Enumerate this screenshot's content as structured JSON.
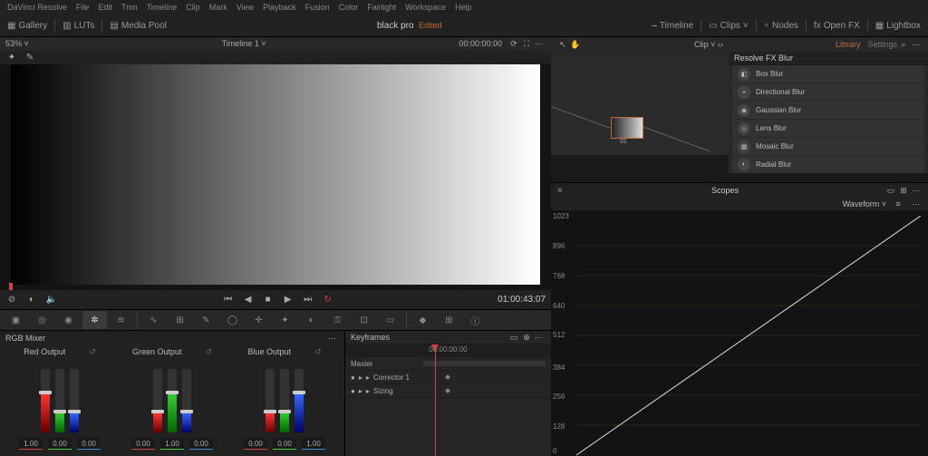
{
  "menubar": [
    "DaVinci Resolve",
    "File",
    "Edit",
    "Trim",
    "Timeline",
    "Clip",
    "Mark",
    "View",
    "Playback",
    "Fusion",
    "Color",
    "Fairlight",
    "Workspace",
    "Help"
  ],
  "topbar": {
    "gallery": "Gallery",
    "luts": "LUTs",
    "mediapool": "Media Pool",
    "project": "black pro",
    "edited": "Edited",
    "timeline": "Timeline",
    "clips": "Clips",
    "nodes": "Nodes",
    "openfx": "Open FX",
    "lightbox": "Lightbox"
  },
  "viewer": {
    "zoom": "53%",
    "title": "Timeline 1",
    "tc_in": "00:00:00:00",
    "tc_master": "01:00:43:07"
  },
  "nodes": {
    "clip_label": "Clip",
    "tab_library": "Library",
    "tab_settings": "Settings",
    "node_label": "01"
  },
  "fx": {
    "header": "Resolve FX Blur",
    "items": [
      "Box Blur",
      "Directional Blur",
      "Gaussian Blur",
      "Lens Blur",
      "Mosaic Blur",
      "Radial Blur"
    ]
  },
  "rgb": {
    "header": "RGB Mixer",
    "red": "Red Output",
    "green": "Green Output",
    "blue": "Blue Output",
    "v1": "1.00",
    "v0": "0.00"
  },
  "kf": {
    "header": "Keyframes",
    "tc": "00:00:00:00",
    "master": "Master",
    "corr": "Corrector 1",
    "sizing": "Sizing"
  },
  "scopes": {
    "header": "Scopes",
    "mode": "Waveform",
    "ticks": [
      "1023",
      "896",
      "768",
      "640",
      "512",
      "384",
      "256",
      "128",
      "0"
    ]
  },
  "chart_data": {
    "type": "line",
    "title": "Waveform",
    "xlabel": "",
    "ylabel": "",
    "ylim": [
      0,
      1023
    ],
    "x": [
      0,
      1
    ],
    "values": [
      0,
      1023
    ]
  }
}
